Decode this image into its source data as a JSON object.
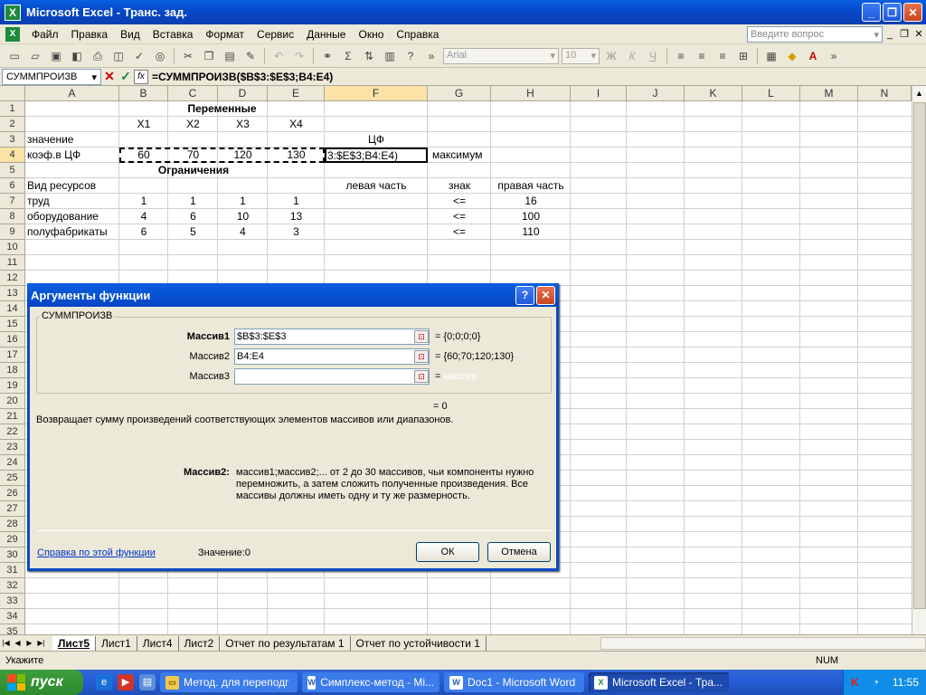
{
  "window": {
    "title": "Microsoft Excel - Транс. зад.",
    "min_label": "_",
    "max_label": "❐",
    "close_label": "✕"
  },
  "menu": {
    "items": [
      "Файл",
      "Правка",
      "Вид",
      "Вставка",
      "Формат",
      "Сервис",
      "Данные",
      "Окно",
      "Справка"
    ],
    "ask_placeholder": "Введите вопрос"
  },
  "toolbar": {
    "font_name": "Arial",
    "font_size": "10"
  },
  "formula_bar": {
    "name_box": "СУММПРОИЗВ",
    "formula": "=СУММПРОИЗВ($B$3:$E$3;B4:E4)"
  },
  "columns": [
    "A",
    "B",
    "C",
    "D",
    "E",
    "F",
    "G",
    "H",
    "I",
    "J",
    "K",
    "L",
    "M",
    "N"
  ],
  "rows": [
    "1",
    "2",
    "3",
    "4",
    "5",
    "6",
    "7",
    "8",
    "9",
    "10",
    "11",
    "12",
    "13",
    "14",
    "15",
    "16",
    "17",
    "18",
    "19",
    "20",
    "21",
    "22",
    "23",
    "24",
    "25",
    "26",
    "27",
    "28",
    "29",
    "30",
    "31",
    "32",
    "33",
    "34",
    "35"
  ],
  "cells": {
    "r1": {
      "title": "Переменные"
    },
    "r2": {
      "B": "X1",
      "C": "X2",
      "D": "X3",
      "E": "X4"
    },
    "r3": {
      "A": "значение",
      "F": "ЦФ"
    },
    "r4": {
      "A": "коэф.в ЦФ",
      "B": "60",
      "C": "70",
      "D": "120",
      "E": "130",
      "F": "3:$E$3;B4:E4)",
      "G": "максимум"
    },
    "r5": {
      "title": "Ограничения"
    },
    "r6": {
      "A": "Вид ресурсов",
      "F": "левая часть",
      "G": "знак",
      "H": "правая часть"
    },
    "r7": {
      "A": "труд",
      "B": "1",
      "C": "1",
      "D": "1",
      "E": "1",
      "G": "<=",
      "H": "16"
    },
    "r8": {
      "A": "оборудование",
      "B": "4",
      "C": "6",
      "D": "10",
      "E": "13",
      "G": "<=",
      "H": "100"
    },
    "r9": {
      "A": "полуфабрикаты",
      "B": "6",
      "C": "5",
      "D": "4",
      "E": "3",
      "G": "<=",
      "H": "110"
    }
  },
  "sheet_tabs": {
    "tabs": [
      "Лист5",
      "Лист1",
      "Лист4",
      "Лист2",
      "Отчет по результатам 1",
      "Отчет по устойчивости 1"
    ],
    "active": "Лист5"
  },
  "status": {
    "mode": "Укажите",
    "num": "NUM"
  },
  "dialog": {
    "title": "Аргументы функции",
    "function_name": "СУММПРОИЗВ",
    "args": [
      {
        "label": "Массив1",
        "value": "$B$3:$E$3",
        "result": "= {0;0;0;0}"
      },
      {
        "label": "Массив2",
        "value": "B4:E4",
        "result": "= {60;70;120;130}"
      },
      {
        "label": "Массив3",
        "value": "",
        "result": "= ",
        "hint": "массив"
      }
    ],
    "formula_result": "= 0",
    "description": "Возвращает сумму произведений соответствующих элементов массивов или диапазонов.",
    "arg_name": "Массив2:",
    "arg_description": "массив1;массив2;... от 2 до 30 массивов, чьи компоненты нужно перемножить, а затем сложить полученные произведения. Все массивы должны иметь одну и ту же размерность.",
    "help_link": "Справка по этой функции",
    "value_label": "Значение:",
    "value": "0",
    "ok_label": "ОК",
    "cancel_label": "Отмена",
    "help_btn": "?",
    "close_btn": "✕"
  },
  "taskbar": {
    "start_label": "пуск",
    "items": [
      {
        "label": "Метод. для переподг",
        "icon": "folder-icon",
        "color": "#f2c94c"
      },
      {
        "label": "Симплекс-метод - Mi...",
        "icon": "word-icon",
        "color": "#2a5caa"
      },
      {
        "label": "Doc1 - Microsoft Word",
        "icon": "word-icon",
        "color": "#2a5caa"
      },
      {
        "label": "Microsoft Excel - Тра...",
        "icon": "excel-icon",
        "color": "#1e8a3c"
      }
    ],
    "clock": "11:55"
  },
  "colors": {
    "title_blue": "#0a5fe0",
    "taskbar_blue": "#245ed8",
    "start_green": "#3c9e3c",
    "selection": "#fbe2a6"
  }
}
